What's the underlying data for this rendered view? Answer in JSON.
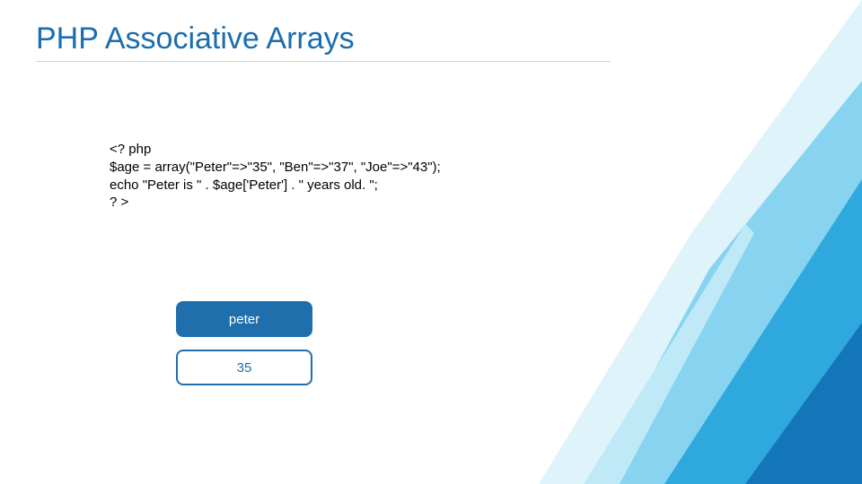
{
  "title": "PHP Associative Arrays",
  "code": {
    "l1": "<? php",
    "l2": "$age = array(\"Peter\"=>\"35\", \"Ben\"=>\"37\", \"Joe\"=>\"43\");",
    "l3": "echo \"Peter is \" . $age['Peter'] . \" years old. \";",
    "l4": "? >"
  },
  "illustration": {
    "key_label": "peter",
    "value_label": "35"
  },
  "colors": {
    "title": "#1a6daf",
    "box_fill": "#1f6fac",
    "underline": "#bde0c9"
  }
}
